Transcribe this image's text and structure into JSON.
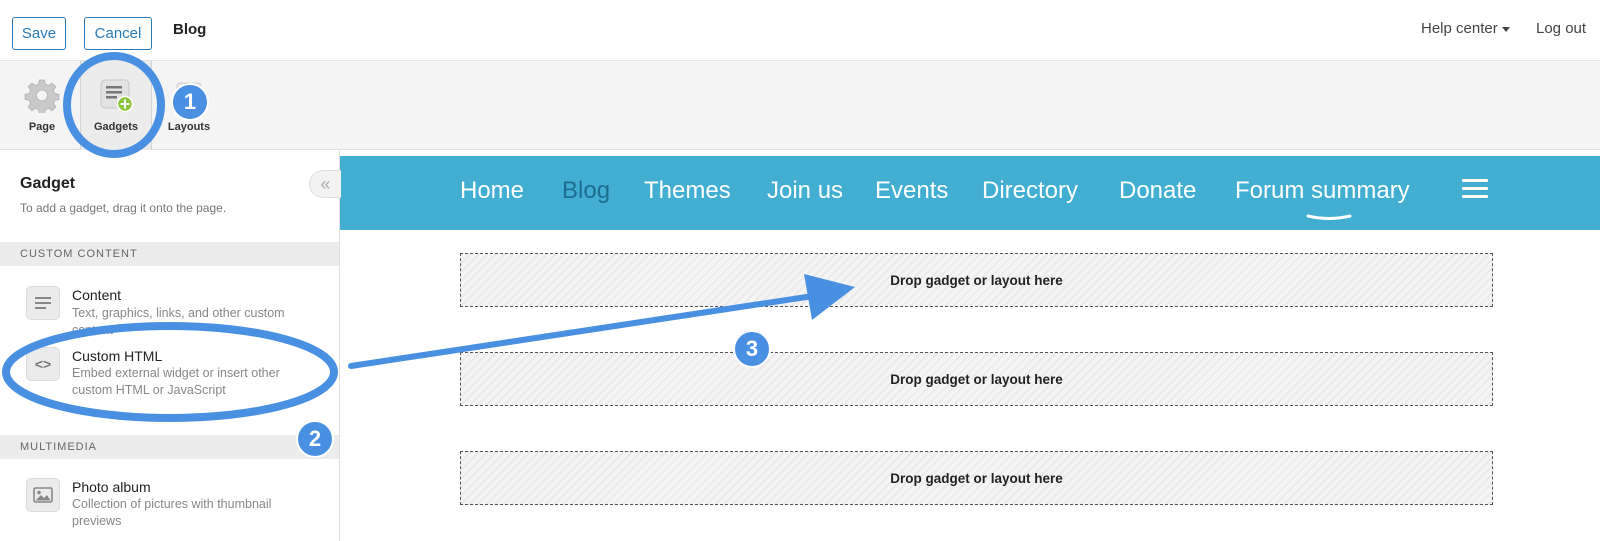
{
  "topbar": {
    "save_label": "Save",
    "cancel_label": "Cancel",
    "page_name": "Blog",
    "help_label": "Help center",
    "logout_label": "Log out"
  },
  "toolbar": {
    "items": [
      {
        "label": "Page",
        "icon": "gear-icon"
      },
      {
        "label": "Gadgets",
        "icon": "gadget-add-icon",
        "selected": true
      },
      {
        "label": "Layouts",
        "icon": "layouts-icon"
      }
    ]
  },
  "sidebar": {
    "title": "Gadget",
    "subtitle": "To add a gadget, drag it onto the page.",
    "collapse_glyph": "«",
    "sections": [
      {
        "header": "CUSTOM CONTENT",
        "items": [
          {
            "name": "Content",
            "description": "Text, graphics, links, and other custom content",
            "icon": "content-lines-icon"
          },
          {
            "name": "Custom HTML",
            "description": "Embed external widget or insert other custom HTML or JavaScript",
            "icon": "code-brackets-icon",
            "glyph": "<>"
          }
        ]
      },
      {
        "header": "MULTIMEDIA",
        "items": [
          {
            "name": "Photo album",
            "description": "Collection of pictures with thumbnail previews",
            "icon": "image-icon"
          }
        ]
      }
    ]
  },
  "nav": {
    "items": [
      "Home",
      "Blog",
      "Themes",
      "Join us",
      "Events",
      "Directory",
      "Donate",
      "Forum summary"
    ],
    "active": "Blog",
    "menu_icon": "hamburger-menu-icon"
  },
  "dropzones": [
    {
      "label": "Drop gadget or layout here"
    },
    {
      "label": "Drop gadget or layout here"
    },
    {
      "label": "Drop gadget or layout here"
    }
  ],
  "annotations": {
    "badges": [
      "1",
      "2",
      "3"
    ],
    "color": "#4a90e2"
  },
  "colors": {
    "nav_band": "#42aed2",
    "nav_active": "#1b6e8e",
    "button_outline": "#2a7ab8",
    "annotation": "#4a90e2"
  }
}
